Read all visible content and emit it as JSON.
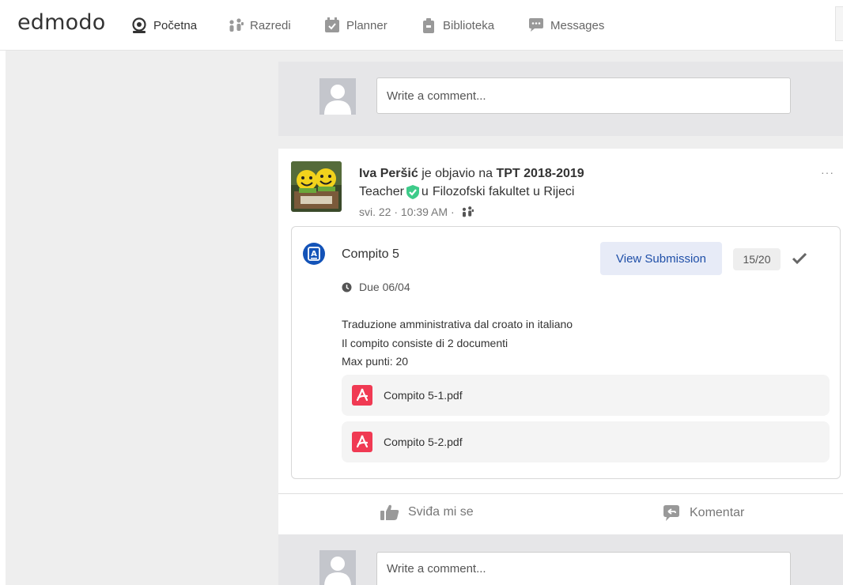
{
  "app": {
    "logo": "edmodo"
  },
  "nav": [
    {
      "label": "Početna",
      "icon": "home-icon"
    },
    {
      "label": "Razredi",
      "icon": "classes-icon"
    },
    {
      "label": "Planner",
      "icon": "planner-icon"
    },
    {
      "label": "Biblioteka",
      "icon": "library-icon"
    },
    {
      "label": "Messages",
      "icon": "messages-icon"
    }
  ],
  "top_comment": {
    "placeholder": "Write a comment..."
  },
  "post": {
    "author": "Iva Peršić",
    "verb": "je objavio na",
    "group": "TPT 2018-2019",
    "role": "Teacher",
    "org_prefix": "u",
    "org": "Filozofski fakultet u Rijeci",
    "time": "svi. 22 · 10:39 AM ·",
    "more": "···",
    "assignment": {
      "title": "Compito 5",
      "view_button": "View Submission",
      "grade": "15/20",
      "due": "Due 06/04",
      "description": [
        "Traduzione amministrativa dal croato in italiano",
        "Il compito consiste di 2 documenti",
        "Max punti: 20"
      ],
      "files": [
        "Compito 5-1.pdf",
        "Compito 5-2.pdf"
      ]
    },
    "actions": {
      "like": "Sviđa mi se",
      "comment": "Komentar"
    }
  },
  "bottom_comment": {
    "placeholder": "Write a comment..."
  },
  "colors": {
    "accent": "#1353b8",
    "pdf": "#f03a53",
    "verified": "#3ecb8a",
    "button_bg": "#e7ebf7"
  }
}
